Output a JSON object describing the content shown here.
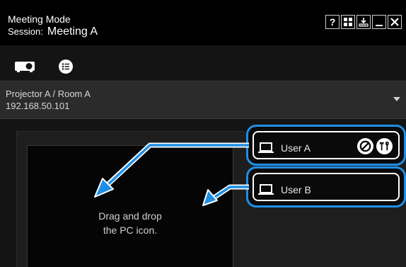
{
  "window": {
    "title": "Meeting Mode",
    "session_label": "Session:",
    "session_name": "Meeting A",
    "controls": [
      {
        "name": "help-button",
        "glyph": "?"
      },
      {
        "name": "layout-button",
        "glyph": "▦"
      },
      {
        "name": "download-button",
        "glyph": "⤓"
      },
      {
        "name": "minimize-button",
        "glyph": "—"
      },
      {
        "name": "close-button",
        "glyph": "✕"
      }
    ]
  },
  "toolbar": {
    "icons": [
      "projector-icon",
      "list-icon"
    ]
  },
  "device": {
    "name": "Projector A / Room A",
    "ip": "192.168.50.101"
  },
  "drop_zone": {
    "text_line1": "Drag and drop",
    "text_line2": "the PC icon."
  },
  "users": [
    {
      "label": "User A",
      "icons": [
        "laptop-icon",
        "block-icon",
        "tools-icon"
      ]
    },
    {
      "label": "User B",
      "icons": [
        "laptop-icon"
      ]
    }
  ],
  "colors": {
    "accent": "#1e8fe6",
    "background": "#141414",
    "titlebar": "#000000"
  }
}
